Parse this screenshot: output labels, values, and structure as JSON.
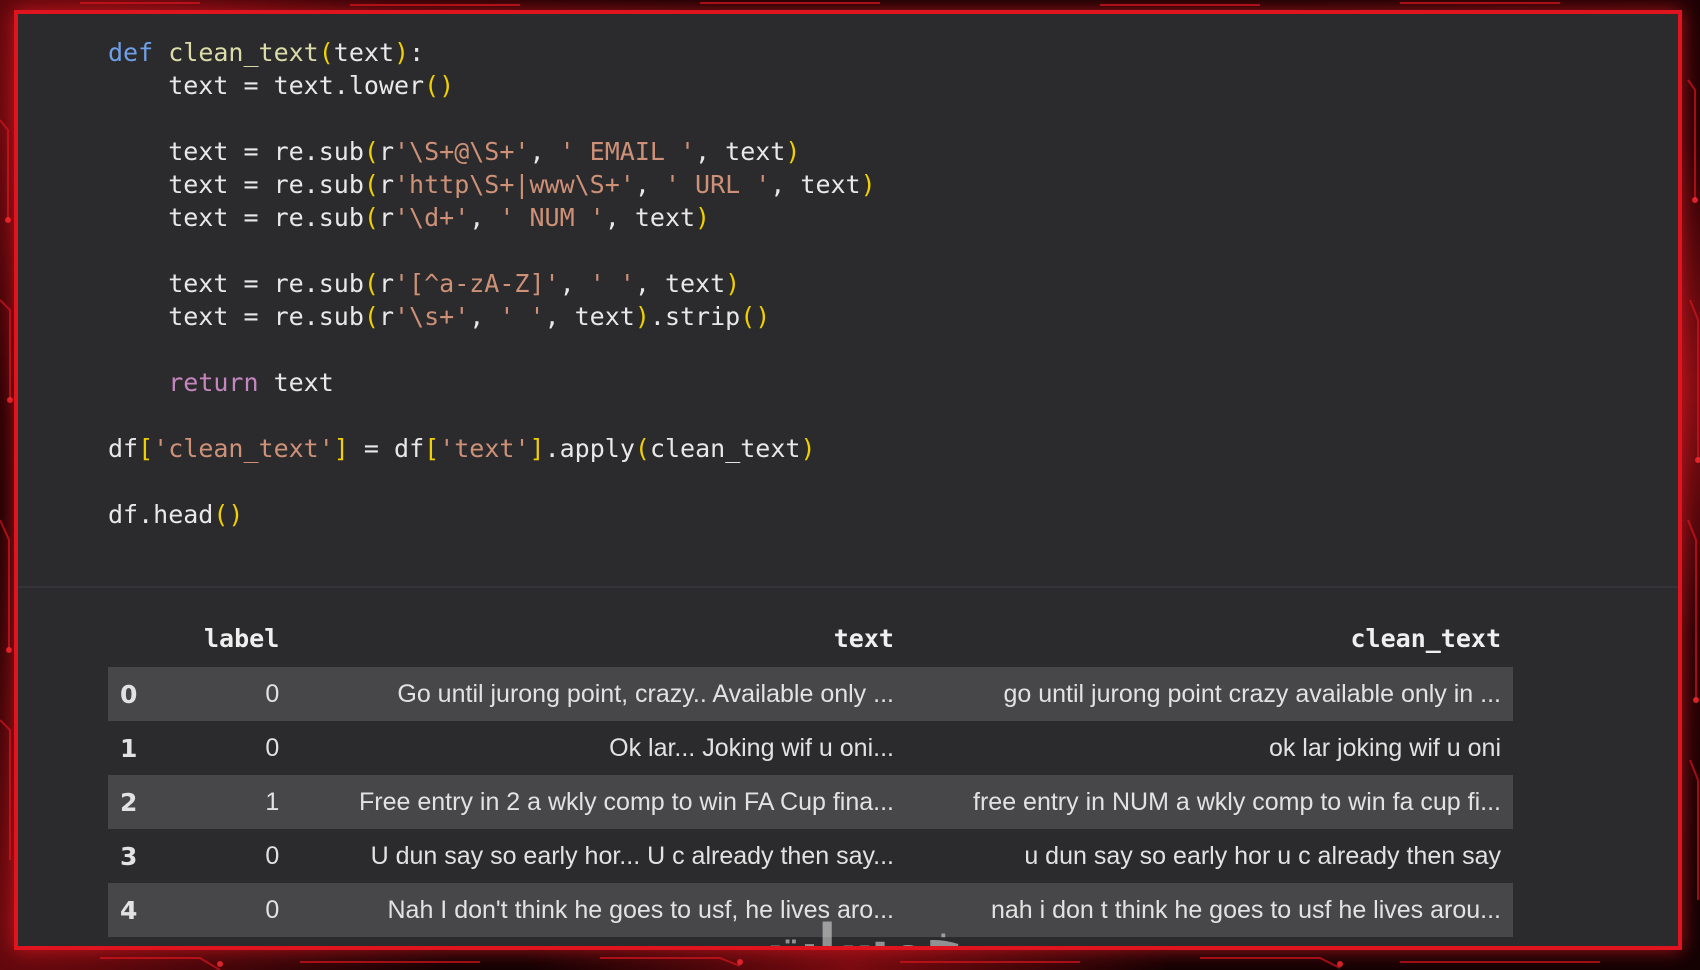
{
  "code": {
    "lines": [
      [
        {
          "t": "def",
          "c": "kw"
        },
        {
          "t": " "
        },
        {
          "t": "clean_text",
          "c": "fn"
        },
        {
          "t": "(",
          "c": "par"
        },
        {
          "t": "text"
        },
        {
          "t": ")",
          "c": "par"
        },
        {
          "t": ":"
        }
      ],
      [
        {
          "t": "    text = text.lower"
        },
        {
          "t": "()",
          "c": "par"
        }
      ],
      [],
      [
        {
          "t": "    text = re.sub"
        },
        {
          "t": "(",
          "c": "par"
        },
        {
          "t": "r"
        },
        {
          "t": "'\\S+@\\S+'",
          "c": "str"
        },
        {
          "t": ", "
        },
        {
          "t": "' EMAIL '",
          "c": "str"
        },
        {
          "t": ", text"
        },
        {
          "t": ")",
          "c": "par"
        }
      ],
      [
        {
          "t": "    text = re.sub"
        },
        {
          "t": "(",
          "c": "par"
        },
        {
          "t": "r"
        },
        {
          "t": "'http\\S+|www\\S+'",
          "c": "str"
        },
        {
          "t": ", "
        },
        {
          "t": "' URL '",
          "c": "str"
        },
        {
          "t": ", text"
        },
        {
          "t": ")",
          "c": "par"
        }
      ],
      [
        {
          "t": "    text = re.sub"
        },
        {
          "t": "(",
          "c": "par"
        },
        {
          "t": "r"
        },
        {
          "t": "'\\d+'",
          "c": "str"
        },
        {
          "t": ", "
        },
        {
          "t": "' NUM '",
          "c": "str"
        },
        {
          "t": ", text"
        },
        {
          "t": ")",
          "c": "par"
        }
      ],
      [],
      [
        {
          "t": "    text = re.sub"
        },
        {
          "t": "(",
          "c": "par"
        },
        {
          "t": "r"
        },
        {
          "t": "'[^a-zA-Z]'",
          "c": "str"
        },
        {
          "t": ", "
        },
        {
          "t": "' '",
          "c": "str"
        },
        {
          "t": ", text"
        },
        {
          "t": ")",
          "c": "par"
        }
      ],
      [
        {
          "t": "    text = re.sub"
        },
        {
          "t": "(",
          "c": "par"
        },
        {
          "t": "r"
        },
        {
          "t": "'\\s+'",
          "c": "str"
        },
        {
          "t": ", "
        },
        {
          "t": "' '",
          "c": "str"
        },
        {
          "t": ", text"
        },
        {
          "t": ")",
          "c": "par"
        },
        {
          "t": ".strip"
        },
        {
          "t": "()",
          "c": "par"
        }
      ],
      [],
      [
        {
          "t": "    "
        },
        {
          "t": "return",
          "c": "kw2"
        },
        {
          "t": " text"
        }
      ],
      [],
      [
        {
          "t": "df"
        },
        {
          "t": "[",
          "c": "par"
        },
        {
          "t": "'clean_text'",
          "c": "str"
        },
        {
          "t": "]",
          "c": "par"
        },
        {
          "t": " = df"
        },
        {
          "t": "[",
          "c": "par"
        },
        {
          "t": "'text'",
          "c": "str"
        },
        {
          "t": "]",
          "c": "par"
        },
        {
          "t": ".apply"
        },
        {
          "t": "(",
          "c": "par"
        },
        {
          "t": "clean_text"
        },
        {
          "t": ")",
          "c": "par"
        }
      ],
      [],
      [
        {
          "t": "df.head"
        },
        {
          "t": "()",
          "c": "par"
        }
      ]
    ]
  },
  "table": {
    "columns": {
      "index": "",
      "label": "label",
      "text": "text",
      "clean_text": "clean_text"
    },
    "rows": [
      {
        "index": "0",
        "label": "0",
        "text": "Go until jurong point, crazy.. Available only ...",
        "clean_text": "go until jurong point crazy available only in ..."
      },
      {
        "index": "1",
        "label": "0",
        "text": "Ok lar... Joking wif u oni...",
        "clean_text": "ok lar joking wif u oni"
      },
      {
        "index": "2",
        "label": "1",
        "text": "Free entry in 2 a wkly comp to win FA Cup fina...",
        "clean_text": "free entry in NUM a wkly comp to win fa cup fi..."
      },
      {
        "index": "3",
        "label": "0",
        "text": "U dun say so early hor... U c already then say...",
        "clean_text": "u dun say so early hor u c already then say"
      },
      {
        "index": "4",
        "label": "0",
        "text": "Nah I don't think he goes to usf, he lives aro...",
        "clean_text": "nah i don t think he goes to usf he lives arou..."
      }
    ]
  },
  "watermark": "خمسات",
  "colors": {
    "keyword": "#6f9fe8",
    "return_keyword": "#c586c0",
    "function_name": "#dcdcaa",
    "string": "#ce9178",
    "bracket": "#f0d000",
    "frame_border": "#e0141e",
    "editor_bg": "#2b2b2d"
  }
}
